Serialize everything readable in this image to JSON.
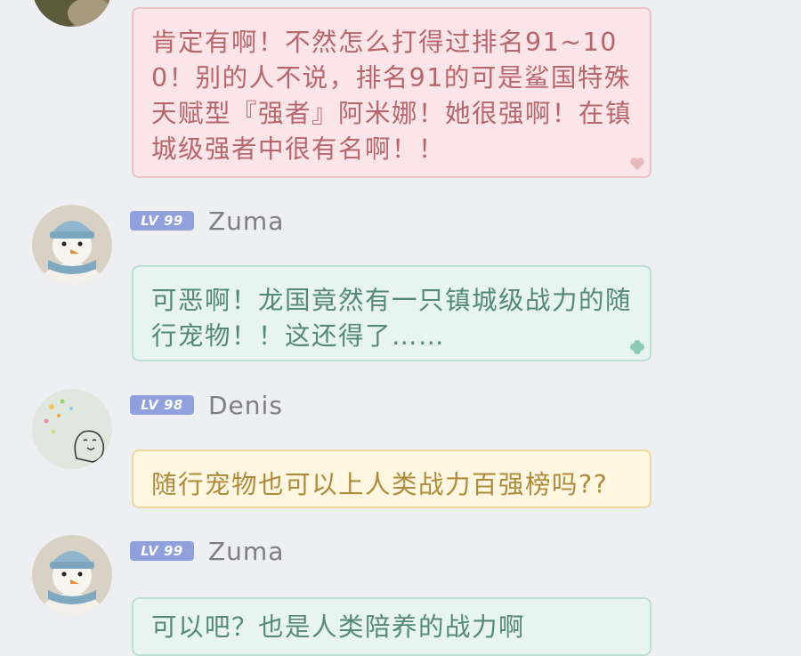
{
  "messages": [
    {
      "id": "m1",
      "text": "肯定有啊！不然怎么打得过排名91~100！别的人不说，排名91的可是鲨国特殊天赋型『强者』阿米娜！她很强啊！在镇城级强者中很有名啊！！",
      "bubble_style": "pink",
      "decoration": "heart-icon"
    },
    {
      "id": "m2",
      "level": "LV 99",
      "username": "Zuma",
      "avatar": "snowman-avatar",
      "text": "可恶啊！龙国竟然有一只镇城级战力的随行宠物！！这还得了……",
      "bubble_style": "green",
      "decoration": "clover-icon"
    },
    {
      "id": "m3",
      "level": "LV 98",
      "username": "Denis",
      "avatar": "doodle-avatar",
      "text": "随行宠物也可以上人类战力百强榜吗??",
      "bubble_style": "yellow"
    },
    {
      "id": "m4",
      "level": "LV 99",
      "username": "Zuma",
      "avatar": "snowman-avatar",
      "text": "可以吧？也是人类陪养的战力啊",
      "bubble_style": "green"
    }
  ],
  "colors": {
    "background": "#eeeff3",
    "level_badge": "#8fa0dd",
    "pink_text": "#b7676c",
    "green_text": "#548878",
    "yellow_text": "#b08a3c"
  }
}
